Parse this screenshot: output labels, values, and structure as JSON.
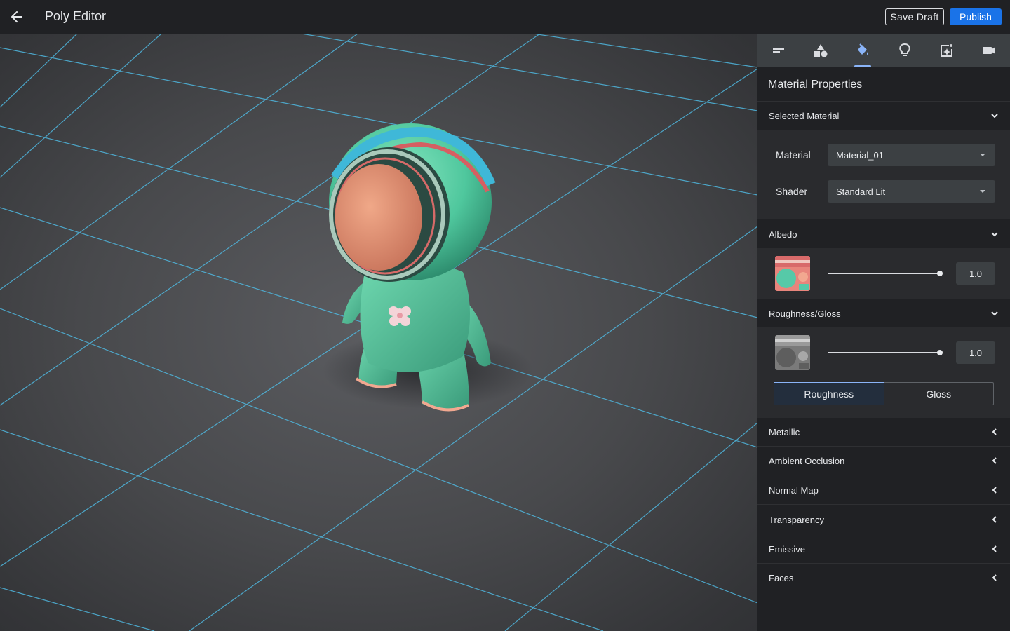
{
  "app": {
    "title": "Poly Editor"
  },
  "header": {
    "save_draft_label": "Save Draft",
    "publish_label": "Publish"
  },
  "colors": {
    "accent": "#1a73e8",
    "tab_active": "#8ab4f8",
    "grid_line": "#4fb8e0"
  },
  "tabs": [
    {
      "icon": "outline-icon",
      "active": false
    },
    {
      "icon": "shapes-icon",
      "active": false
    },
    {
      "icon": "paint-bucket-icon",
      "active": true
    },
    {
      "icon": "lightbulb-icon",
      "active": false
    },
    {
      "icon": "image-sparkle-icon",
      "active": false
    },
    {
      "icon": "camera-icon",
      "active": false
    }
  ],
  "panel": {
    "title": "Material Properties",
    "selected_material": {
      "label": "Selected Material",
      "material_label": "Material",
      "material_value": "Material_01",
      "shader_label": "Shader",
      "shader_value": "Standard Lit"
    },
    "albedo": {
      "label": "Albedo",
      "value": "1.0",
      "slider_fraction": 1.0
    },
    "roughness": {
      "label": "Roughness/Gloss",
      "value": "1.0",
      "slider_fraction": 1.0,
      "toggle": [
        "Roughness",
        "Gloss"
      ],
      "active_toggle": "Roughness"
    },
    "collapsed_sections": [
      "Metallic",
      "Ambient Occlusion",
      "Normal Map",
      "Transparency",
      "Emissive",
      "Faces"
    ]
  }
}
